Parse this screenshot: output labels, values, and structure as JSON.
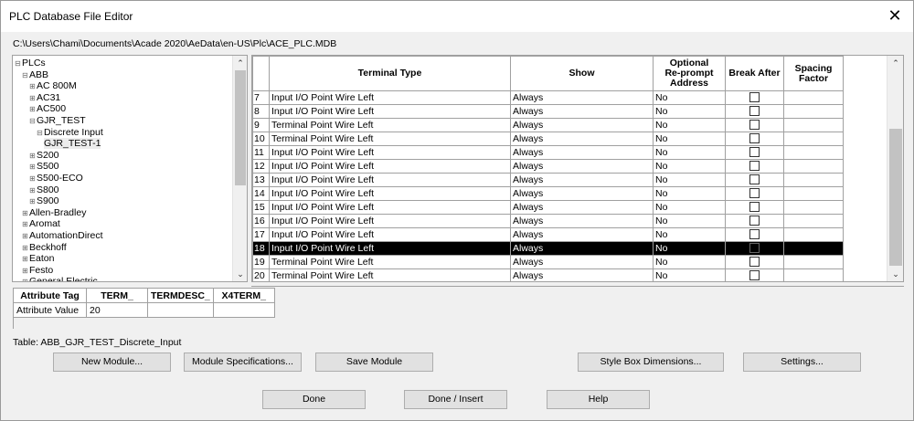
{
  "window": {
    "title": "PLC Database File Editor",
    "close_glyph": "✕"
  },
  "file_path": "C:\\Users\\Chami\\Documents\\Acade 2020\\AeData\\en-US\\Plc\\ACE_PLC.MDB",
  "tree": {
    "items": [
      {
        "label": "PLCs",
        "expander": "⊟",
        "level": 0
      },
      {
        "label": "ABB",
        "expander": "⊟",
        "level": 1
      },
      {
        "label": "AC 800M",
        "expander": "⊞",
        "level": 2
      },
      {
        "label": "AC31",
        "expander": "⊞",
        "level": 2
      },
      {
        "label": "AC500",
        "expander": "⊞",
        "level": 2
      },
      {
        "label": "GJR_TEST",
        "expander": "⊟",
        "level": 2
      },
      {
        "label": "Discrete Input",
        "expander": "⊟",
        "level": 3
      },
      {
        "label": "GJR_TEST-1",
        "expander": "",
        "level": 4,
        "selected": true
      },
      {
        "label": "S200",
        "expander": "⊞",
        "level": 2
      },
      {
        "label": "S500",
        "expander": "⊞",
        "level": 2
      },
      {
        "label": "S500-ECO",
        "expander": "⊞",
        "level": 2
      },
      {
        "label": "S800",
        "expander": "⊞",
        "level": 2
      },
      {
        "label": "S900",
        "expander": "⊞",
        "level": 2
      },
      {
        "label": "Allen-Bradley",
        "expander": "⊞",
        "level": 1
      },
      {
        "label": "Aromat",
        "expander": "⊞",
        "level": 1
      },
      {
        "label": "AutomationDirect",
        "expander": "⊞",
        "level": 1
      },
      {
        "label": "Beckhoff",
        "expander": "⊞",
        "level": 1
      },
      {
        "label": "Eaton",
        "expander": "⊞",
        "level": 1
      },
      {
        "label": "Festo",
        "expander": "⊞",
        "level": 1
      },
      {
        "label": "General Electric",
        "expander": "⊞",
        "level": 1
      }
    ]
  },
  "grid": {
    "columns": {
      "terminal_type": "Terminal Type",
      "show": "Show",
      "optional_reprompt": "Optional\nRe-prompt\nAddress",
      "break_after": "Break After",
      "spacing_factor": "Spacing\nFactor"
    },
    "rows": [
      {
        "num": "7",
        "terminal_type": "Input I/O Point Wire Left",
        "show": "Always",
        "reprompt": "No"
      },
      {
        "num": "8",
        "terminal_type": "Input I/O Point Wire Left",
        "show": "Always",
        "reprompt": "No"
      },
      {
        "num": "9",
        "terminal_type": "Terminal Point Wire Left",
        "show": "Always",
        "reprompt": "No"
      },
      {
        "num": "10",
        "terminal_type": "Terminal Point Wire Left",
        "show": "Always",
        "reprompt": "No"
      },
      {
        "num": "11",
        "terminal_type": "Input I/O Point Wire Left",
        "show": "Always",
        "reprompt": "No"
      },
      {
        "num": "12",
        "terminal_type": "Input I/O Point Wire Left",
        "show": "Always",
        "reprompt": "No"
      },
      {
        "num": "13",
        "terminal_type": "Input I/O Point Wire Left",
        "show": "Always",
        "reprompt": "No"
      },
      {
        "num": "14",
        "terminal_type": "Input I/O Point Wire Left",
        "show": "Always",
        "reprompt": "No"
      },
      {
        "num": "15",
        "terminal_type": "Input I/O Point Wire Left",
        "show": "Always",
        "reprompt": "No"
      },
      {
        "num": "16",
        "terminal_type": "Input I/O Point Wire Left",
        "show": "Always",
        "reprompt": "No"
      },
      {
        "num": "17",
        "terminal_type": "Input I/O Point Wire Left",
        "show": "Always",
        "reprompt": "No"
      },
      {
        "num": "18",
        "terminal_type": "Input I/O Point Wire Left",
        "show": "Always",
        "reprompt": "No",
        "selected": true
      },
      {
        "num": "19",
        "terminal_type": "Terminal Point Wire Left",
        "show": "Always",
        "reprompt": "No"
      },
      {
        "num": "20",
        "terminal_type": "Terminal Point Wire Left",
        "show": "Always",
        "reprompt": "No"
      }
    ]
  },
  "attributes": {
    "headers": [
      "Attribute Tag",
      "TERM_",
      "TERMDESC_",
      "X4TERM_"
    ],
    "row_label": "Attribute Value",
    "values": [
      "20",
      "",
      ""
    ]
  },
  "table_name": "Table: ABB_GJR_TEST_Discrete_Input",
  "buttons": {
    "new_module": "New Module...",
    "module_specs": "Module Specifications...",
    "save_module": "Save Module",
    "style_box": "Style Box Dimensions...",
    "settings": "Settings...",
    "done": "Done",
    "done_insert": "Done / Insert",
    "help": "Help"
  },
  "icons": {
    "scroll_up": "⌃",
    "scroll_down": "⌄"
  }
}
